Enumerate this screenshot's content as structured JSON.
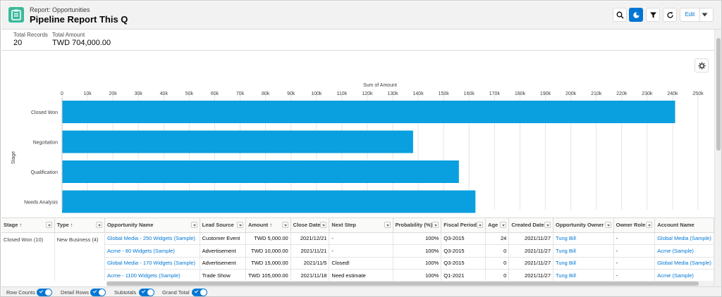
{
  "header": {
    "breadcrumb": "Report: Opportunities",
    "title": "Pipeline Report This Q",
    "edit_label": "Edit"
  },
  "summary": {
    "total_records_label": "Total Records",
    "total_records_value": "20",
    "total_amount_label": "Total Amount",
    "total_amount_value": "TWD 704,000.00"
  },
  "colors": {
    "bar": "#0a9fde",
    "accent": "#0176d3",
    "app_icon": "#3bba9c"
  },
  "chart_data": {
    "type": "bar",
    "orientation": "horizontal",
    "title": "Sum of Amount",
    "xlabel": "Sum of Amount",
    "ylabel": "Stage",
    "categories": [
      "Closed Won",
      "Negotiation",
      "Qualification",
      "Needs Analysis"
    ],
    "values": [
      241000,
      138000,
      156000,
      162500
    ],
    "xlim": [
      0,
      250000
    ],
    "xticks": [
      "0",
      "10k",
      "20k",
      "30k",
      "40k",
      "50k",
      "60k",
      "70k",
      "80k",
      "90k",
      "100k",
      "110k",
      "120k",
      "130k",
      "140k",
      "150k",
      "160k",
      "170k",
      "180k",
      "190k",
      "200k",
      "210k",
      "220k",
      "230k",
      "240k",
      "250k"
    ],
    "grid": true,
    "axis_position": "top"
  },
  "table": {
    "columns": [
      "Stage",
      "Type",
      "Opportunity Name",
      "Lead Source",
      "Amount",
      "Close Date",
      "Next Step",
      "Probability (%)",
      "Fiscal Period",
      "Age",
      "Created Date",
      "Opportunity Owner",
      "Owner Role",
      "Account Name"
    ],
    "group_stage": "Closed Won (10)",
    "group_type": "New Business (4)",
    "rows": [
      [
        "Global Media - 250 Widgets (Sample)",
        "Customer Event",
        "TWD 5,000.00",
        "2021/12/21",
        "-",
        "100%",
        "Q3-2015",
        "24",
        "2021/11/27",
        "Tung Bill",
        "-",
        "Global Media (Sample)"
      ],
      [
        "Acme - 80 Widgets (Sample)",
        "Advertisement",
        "TWD 10,000.00",
        "2021/11/21",
        "-",
        "100%",
        "Q3-2015",
        "0",
        "2021/11/27",
        "Tung Bill",
        "-",
        "Acme (Sample)"
      ],
      [
        "Global Media - 170 Widgets (Sample)",
        "Advertisement",
        "TWD 15,000.00",
        "2021/11/5",
        "Closed!",
        "100%",
        "Q3-2015",
        "0",
        "2021/11/27",
        "Tung Bill",
        "-",
        "Global Media (Sample)"
      ],
      [
        "Acme - 1100 Widgets (Sample)",
        "Trade Show",
        "TWD 105,000.00",
        "2021/11/18",
        "Need estimate",
        "100%",
        "Q1-2021",
        "0",
        "2021/11/27",
        "Tung Bill",
        "-",
        "Acme (Sample)"
      ]
    ]
  },
  "footer": {
    "row_counts": "Row Counts",
    "detail_rows": "Detail Rows",
    "subtotals": "Subtotals",
    "grand_total": "Grand Total"
  }
}
